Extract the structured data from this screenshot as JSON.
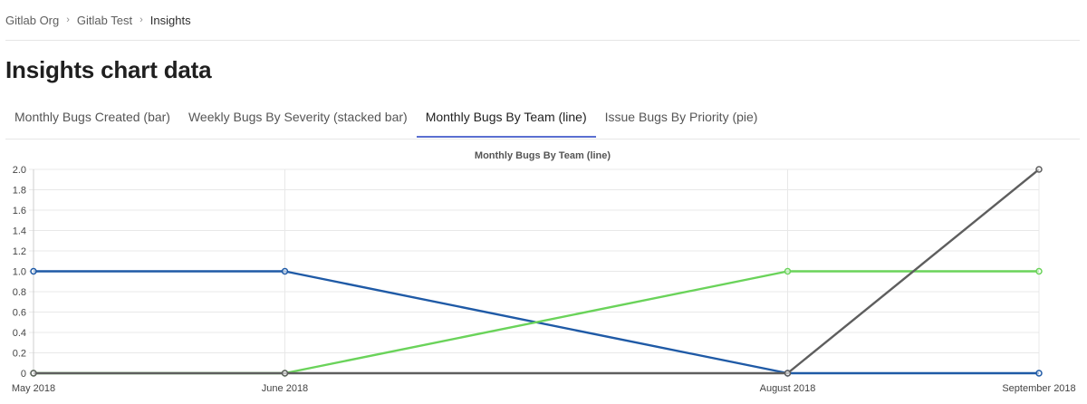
{
  "breadcrumb": {
    "items": [
      "Gitlab Org",
      "Gitlab Test",
      "Insights"
    ],
    "separator_icon": "chevron-right-icon"
  },
  "page": {
    "title": "Insights chart data"
  },
  "tabs": [
    {
      "label": "Monthly Bugs Created (bar)",
      "active": false
    },
    {
      "label": "Weekly Bugs By Severity (stacked bar)",
      "active": false
    },
    {
      "label": "Monthly Bugs By Team (line)",
      "active": true
    },
    {
      "label": "Issue Bugs By Priority (pie)",
      "active": false
    }
  ],
  "colors": {
    "active_tab_underline": "#5a6fd0"
  },
  "chart_data": {
    "type": "line",
    "title": "Monthly Bugs By Team (line)",
    "categories": [
      "May 2018",
      "June 2018",
      "August 2018",
      "September 2018"
    ],
    "ylim": [
      0,
      2
    ],
    "yticks": [
      "0",
      "0.2",
      "0.4",
      "0.6",
      "0.8",
      "1.0",
      "1.2",
      "1.4",
      "1.6",
      "1.8",
      "2.0"
    ],
    "grid": true,
    "series": [
      {
        "color": "#1f5aa6",
        "values": [
          1,
          1,
          0,
          0
        ]
      },
      {
        "color": "#6ad35a",
        "values": [
          0,
          0,
          1,
          1
        ]
      },
      {
        "color": "#5e5e5e",
        "values": [
          0,
          0,
          0,
          2
        ]
      }
    ]
  }
}
